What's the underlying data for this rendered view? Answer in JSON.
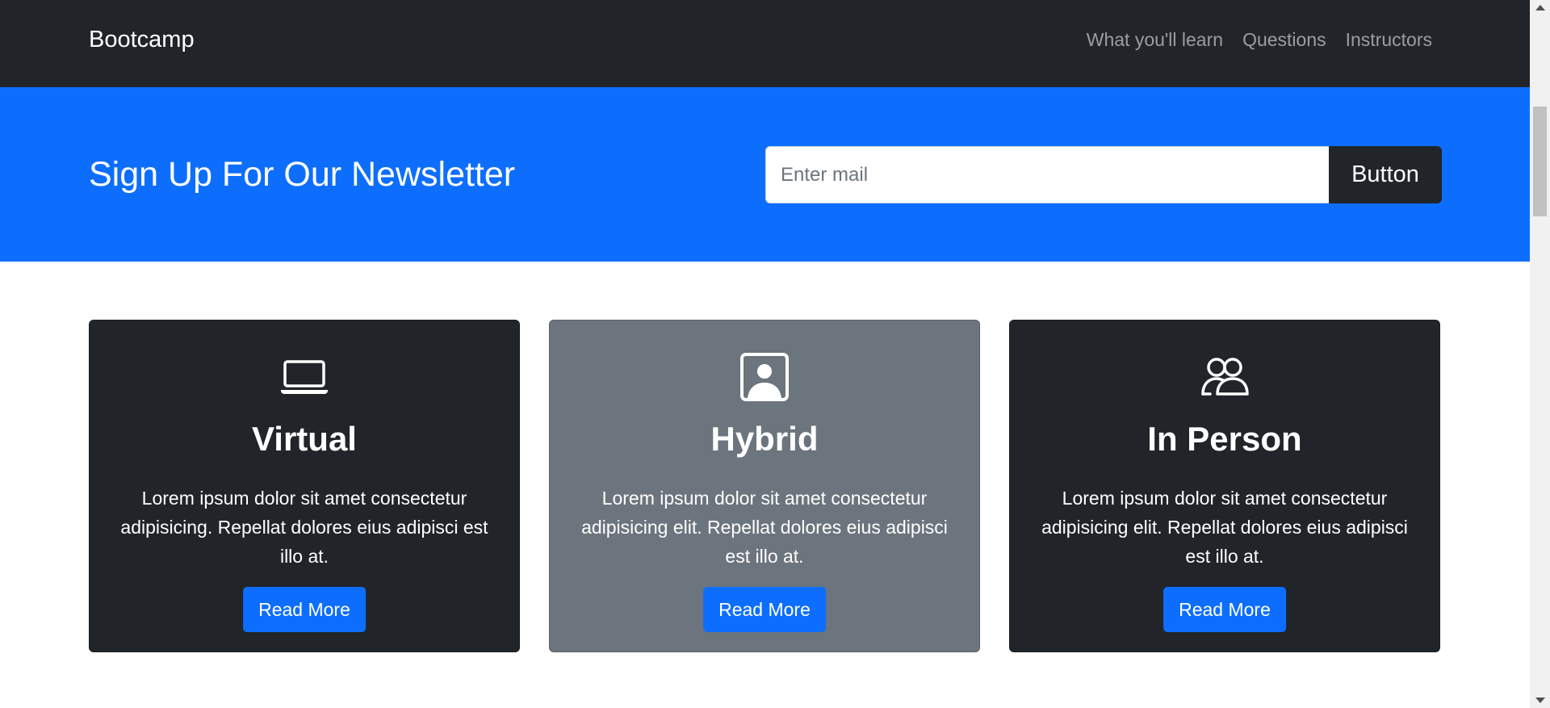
{
  "navbar": {
    "brand": "Bootcamp",
    "links": [
      {
        "label": "What you'll learn"
      },
      {
        "label": "Questions"
      },
      {
        "label": "Instructors"
      }
    ]
  },
  "newsletter": {
    "title": "Sign Up For Our Newsletter",
    "email_placeholder": "Enter mail",
    "email_value": "",
    "button_label": "Button"
  },
  "cards": [
    {
      "icon": "laptop-icon",
      "title": "Virtual",
      "text": "Lorem ipsum dolor sit amet consectetur adipisicing. Repellat dolores eius adipisci est illo at.",
      "button_label": "Read More"
    },
    {
      "icon": "person-square-icon",
      "title": "Hybrid",
      "text": "Lorem ipsum dolor sit amet consectetur adipisicing elit. Repellat dolores eius adipisci est illo at.",
      "button_label": "Read More"
    },
    {
      "icon": "people-icon",
      "title": "In Person",
      "text": "Lorem ipsum dolor sit amet consectetur adipisicing elit. Repellat dolores eius adipisci est illo at.",
      "button_label": "Read More"
    }
  ],
  "colors": {
    "dark": "#212529",
    "primary": "#0d6efd",
    "secondary": "#6c757d"
  }
}
